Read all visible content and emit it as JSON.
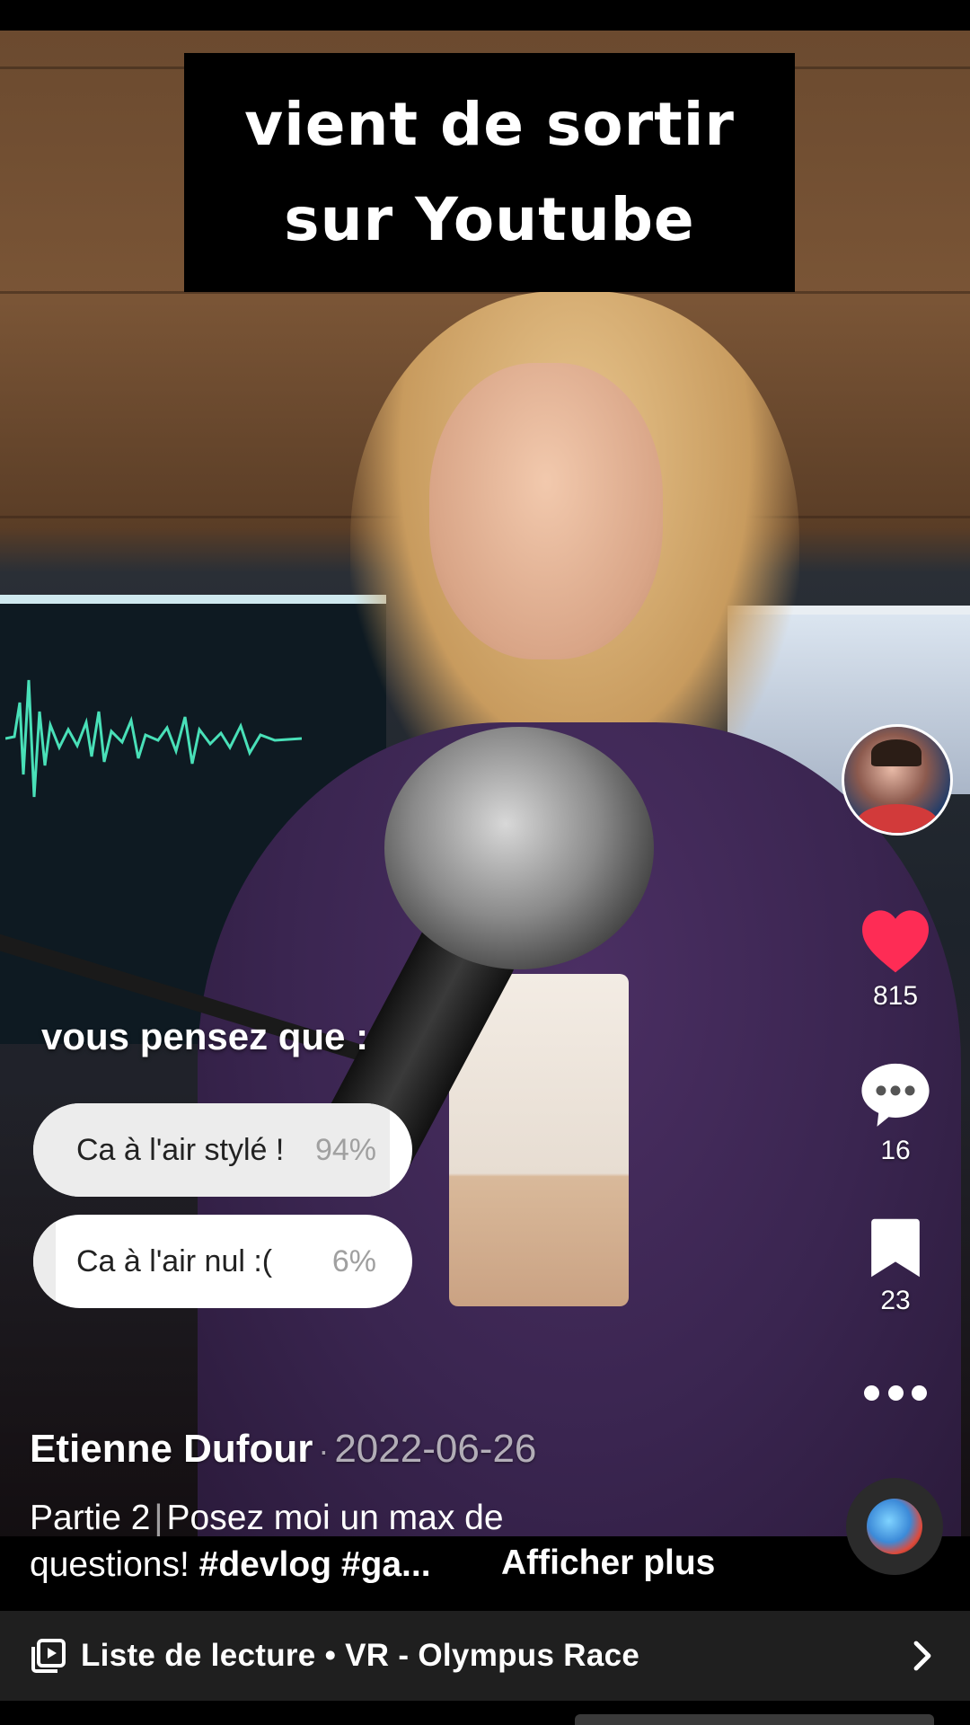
{
  "video": {
    "overlay_caption_line1": "vient de sortir",
    "overlay_caption_line2": "sur Youtube"
  },
  "rail": {
    "avatar_icon": "creator-avatar",
    "like_count": "815",
    "comment_count": "16",
    "bookmark_count": "23",
    "like_color": "#fe2c55"
  },
  "poll": {
    "question": "vous pensez que :",
    "options": [
      {
        "label": "Ca à l'air stylé !",
        "percent_text": "94%",
        "percent": 94
      },
      {
        "label": "Ca à l'air nul :(",
        "percent_text": "6%",
        "percent": 6
      }
    ]
  },
  "info": {
    "author": "Etienne Dufour",
    "date": "2022-06-26",
    "separator": "·",
    "description_part": "Partie 2",
    "description_bar": "|",
    "description_text": "Posez moi un max de",
    "description_line2": "questions!",
    "hashtags": "#devlog #ga...",
    "more_label": "Afficher plus"
  },
  "playlist": {
    "label": "Liste de lecture • VR - Olympus Race"
  }
}
